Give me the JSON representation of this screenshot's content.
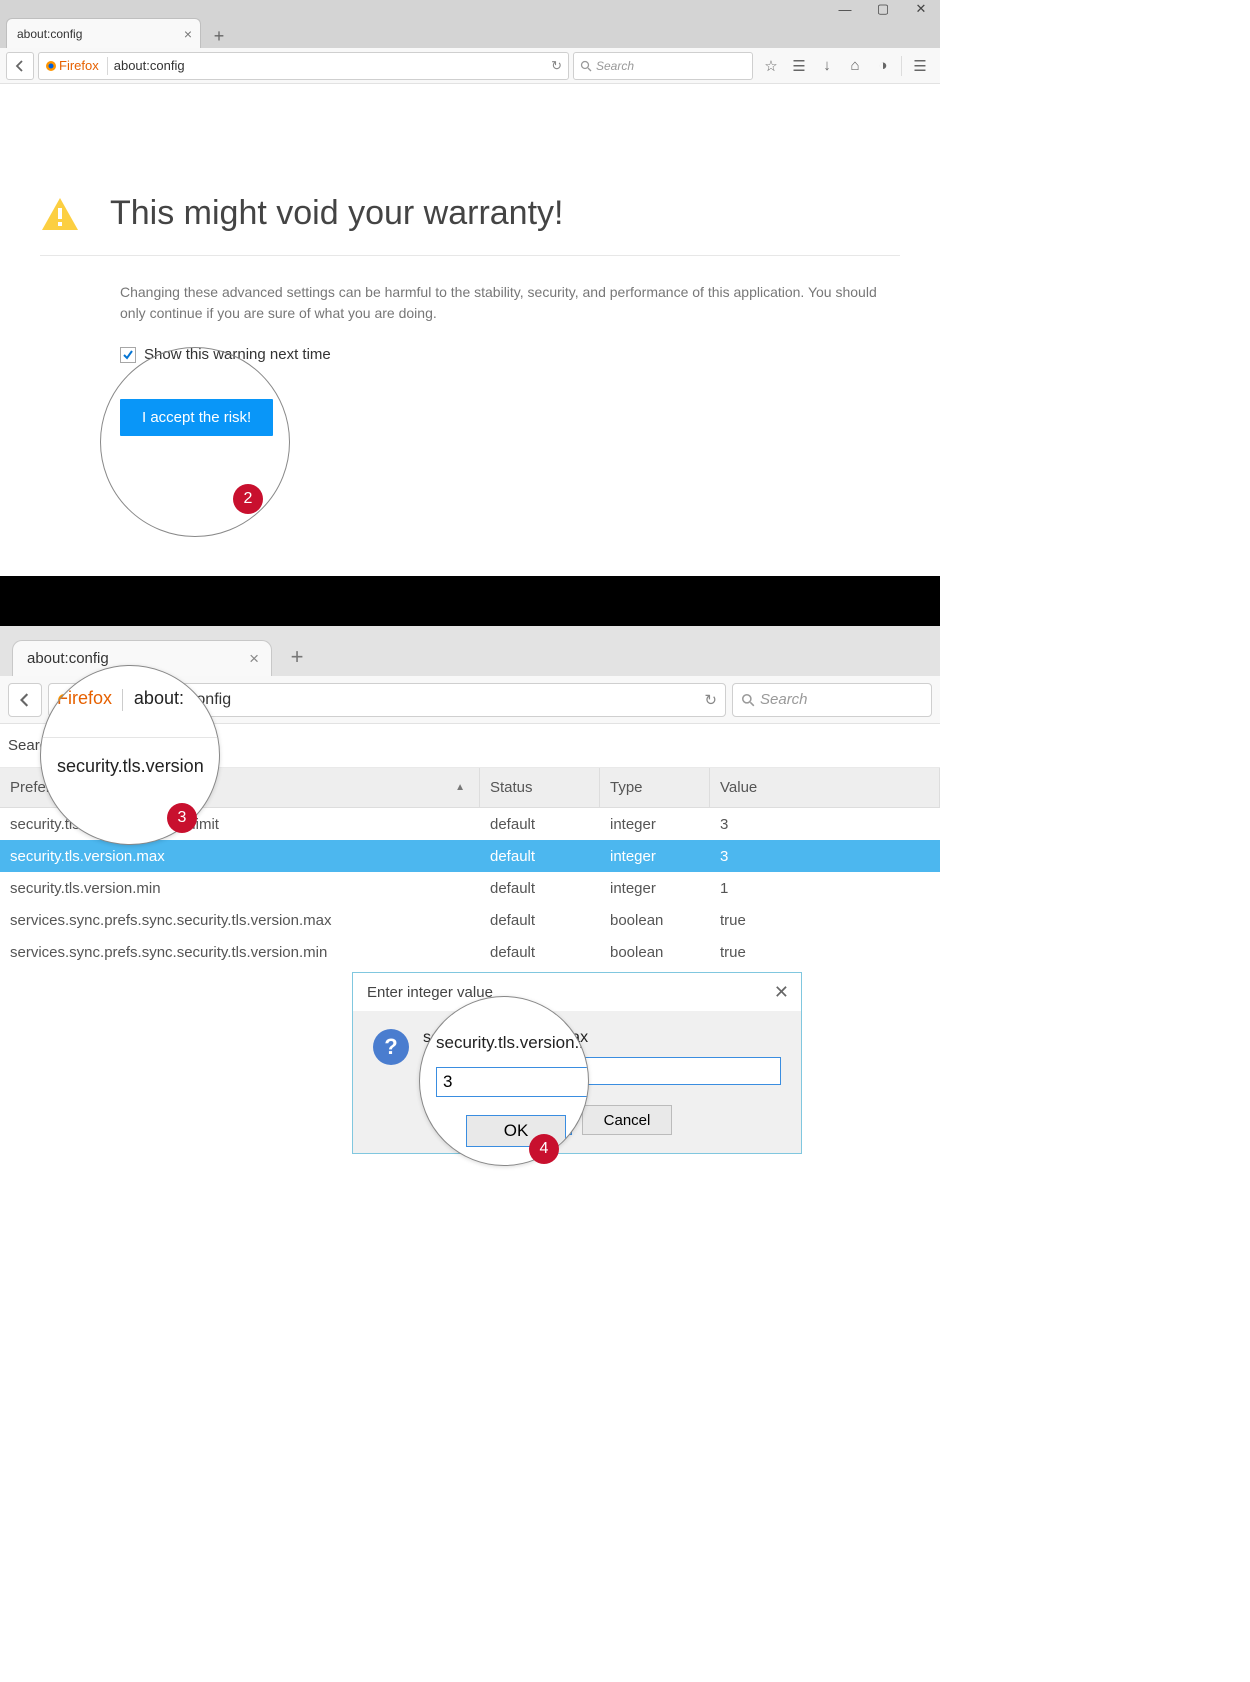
{
  "win1": {
    "tab_title": "about:config",
    "fx_label": "Firefox",
    "url": "about:config",
    "search_placeholder": "Search",
    "warn": {
      "title": "This might void your warranty!",
      "body": "Changing these advanced settings can be harmful to the stability, security, and performance of this application. You should only continue if you are sure of what you are doing.",
      "checkbox_label": "Show this warning next time",
      "accept": "I accept the risk!"
    },
    "badge": "2"
  },
  "win2": {
    "tab_title": "about:config",
    "fx_label": "Firefox",
    "url": "about:config",
    "search_placeholder": "Search",
    "filter_label": "Search:",
    "filter_value": "security.tls.version",
    "mag": {
      "fx": "Firefox",
      "about": "about:",
      "sec": "security.tls.version"
    },
    "headers": {
      "name": "Preference Name",
      "status": "Status",
      "type": "Type",
      "value": "Value"
    },
    "rows": [
      {
        "name": "security.tls.version.fallback-limit",
        "status": "default",
        "type": "integer",
        "value": "3",
        "sel": false
      },
      {
        "name": "security.tls.version.max",
        "status": "default",
        "type": "integer",
        "value": "3",
        "sel": true
      },
      {
        "name": "security.tls.version.min",
        "status": "default",
        "type": "integer",
        "value": "1",
        "sel": false
      },
      {
        "name": "services.sync.prefs.sync.security.tls.version.max",
        "status": "default",
        "type": "boolean",
        "value": "true",
        "sel": false
      },
      {
        "name": "services.sync.prefs.sync.security.tls.version.min",
        "status": "default",
        "type": "boolean",
        "value": "true",
        "sel": false
      }
    ],
    "dialog": {
      "title": "Enter integer value",
      "label": "security.tls.version.max",
      "value": "3",
      "ok": "OK",
      "cancel": "Cancel"
    },
    "badge3": "3",
    "badge4": "4"
  }
}
